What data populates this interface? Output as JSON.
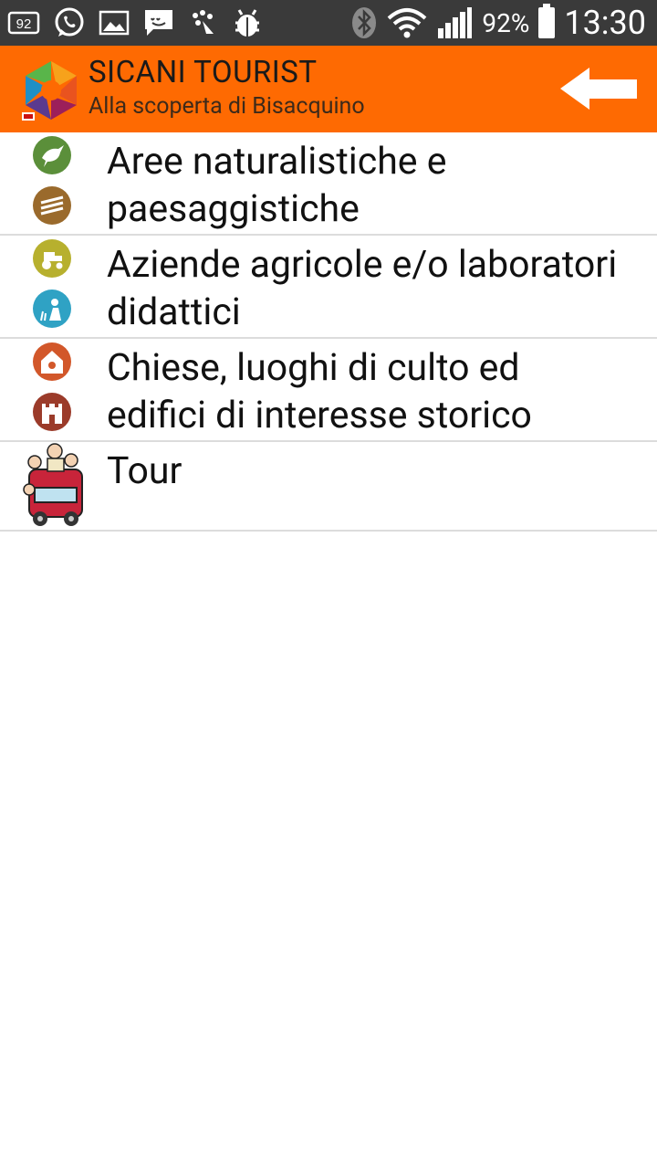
{
  "status_bar": {
    "notif_badge": "92",
    "battery_percent": "92%",
    "time": "13:30"
  },
  "app_bar": {
    "title": "SICANI TOURIST",
    "subtitle": "Alla scoperta di Bisacquino"
  },
  "categories": [
    {
      "label": "Aree naturalistiche e\npaesaggistiche",
      "icons": [
        "bird-icon",
        "landscape-icon"
      ]
    },
    {
      "label": "Aziende agricole e/o laboratori\ndidattici",
      "icons": [
        "tractor-icon",
        "farm-worker-icon"
      ]
    },
    {
      "label": "Chiese, luoghi di culto ed\nedifici di interesse storico",
      "icons": [
        "church-icon",
        "castle-icon"
      ]
    },
    {
      "label": "Tour",
      "icons": [
        "tour-bus-icon"
      ]
    }
  ],
  "colors": {
    "status_bar": "#3a3a3a",
    "app_bar": "#fe6a02",
    "divider": "#dcdcdc"
  }
}
